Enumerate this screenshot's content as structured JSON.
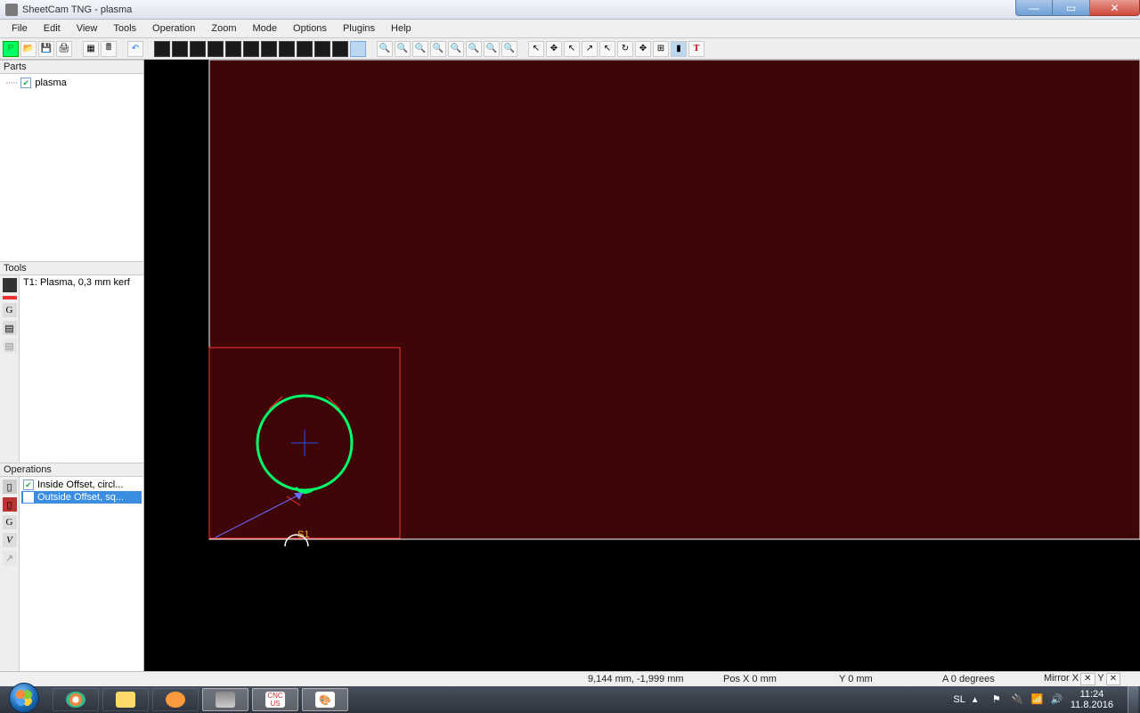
{
  "title": "SheetCam TNG - plasma",
  "menu": [
    "File",
    "Edit",
    "View",
    "Tools",
    "Operation",
    "Zoom",
    "Mode",
    "Options",
    "Plugins",
    "Help"
  ],
  "panels": {
    "parts": {
      "title": "Parts",
      "item": "plasma"
    },
    "tools": {
      "title": "Tools",
      "item": "T1: Plasma, 0,3 mm kerf"
    },
    "ops": {
      "title": "Operations",
      "op1": "Inside Offset, circl...",
      "op2": "Outside Offset, sq..."
    }
  },
  "canvas": {
    "start_label": "S1"
  },
  "status": {
    "cursor": "9,144 mm, -1,999 mm",
    "posx": "Pos X  0 mm",
    "posy": "Y  0 mm",
    "angle": "A  0 degrees",
    "mirrorx": "Mirror X",
    "mirrory": "Y"
  },
  "taskbar": {
    "lang": "SL",
    "time": "11:24",
    "date": "11.8.2016"
  }
}
